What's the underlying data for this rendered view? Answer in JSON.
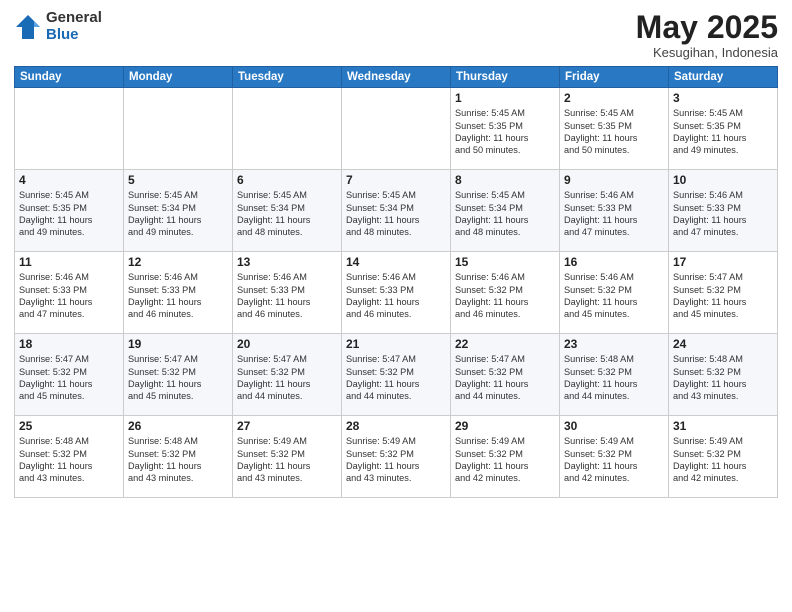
{
  "logo": {
    "general": "General",
    "blue": "Blue"
  },
  "header": {
    "month": "May 2025",
    "location": "Kesugihan, Indonesia"
  },
  "days_of_week": [
    "Sunday",
    "Monday",
    "Tuesday",
    "Wednesday",
    "Thursday",
    "Friday",
    "Saturday"
  ],
  "weeks": [
    [
      {
        "day": "",
        "detail": ""
      },
      {
        "day": "",
        "detail": ""
      },
      {
        "day": "",
        "detail": ""
      },
      {
        "day": "",
        "detail": ""
      },
      {
        "day": "1",
        "detail": "Sunrise: 5:45 AM\nSunset: 5:35 PM\nDaylight: 11 hours\nand 50 minutes."
      },
      {
        "day": "2",
        "detail": "Sunrise: 5:45 AM\nSunset: 5:35 PM\nDaylight: 11 hours\nand 50 minutes."
      },
      {
        "day": "3",
        "detail": "Sunrise: 5:45 AM\nSunset: 5:35 PM\nDaylight: 11 hours\nand 49 minutes."
      }
    ],
    [
      {
        "day": "4",
        "detail": "Sunrise: 5:45 AM\nSunset: 5:35 PM\nDaylight: 11 hours\nand 49 minutes."
      },
      {
        "day": "5",
        "detail": "Sunrise: 5:45 AM\nSunset: 5:34 PM\nDaylight: 11 hours\nand 49 minutes."
      },
      {
        "day": "6",
        "detail": "Sunrise: 5:45 AM\nSunset: 5:34 PM\nDaylight: 11 hours\nand 48 minutes."
      },
      {
        "day": "7",
        "detail": "Sunrise: 5:45 AM\nSunset: 5:34 PM\nDaylight: 11 hours\nand 48 minutes."
      },
      {
        "day": "8",
        "detail": "Sunrise: 5:45 AM\nSunset: 5:34 PM\nDaylight: 11 hours\nand 48 minutes."
      },
      {
        "day": "9",
        "detail": "Sunrise: 5:46 AM\nSunset: 5:33 PM\nDaylight: 11 hours\nand 47 minutes."
      },
      {
        "day": "10",
        "detail": "Sunrise: 5:46 AM\nSunset: 5:33 PM\nDaylight: 11 hours\nand 47 minutes."
      }
    ],
    [
      {
        "day": "11",
        "detail": "Sunrise: 5:46 AM\nSunset: 5:33 PM\nDaylight: 11 hours\nand 47 minutes."
      },
      {
        "day": "12",
        "detail": "Sunrise: 5:46 AM\nSunset: 5:33 PM\nDaylight: 11 hours\nand 46 minutes."
      },
      {
        "day": "13",
        "detail": "Sunrise: 5:46 AM\nSunset: 5:33 PM\nDaylight: 11 hours\nand 46 minutes."
      },
      {
        "day": "14",
        "detail": "Sunrise: 5:46 AM\nSunset: 5:33 PM\nDaylight: 11 hours\nand 46 minutes."
      },
      {
        "day": "15",
        "detail": "Sunrise: 5:46 AM\nSunset: 5:32 PM\nDaylight: 11 hours\nand 46 minutes."
      },
      {
        "day": "16",
        "detail": "Sunrise: 5:46 AM\nSunset: 5:32 PM\nDaylight: 11 hours\nand 45 minutes."
      },
      {
        "day": "17",
        "detail": "Sunrise: 5:47 AM\nSunset: 5:32 PM\nDaylight: 11 hours\nand 45 minutes."
      }
    ],
    [
      {
        "day": "18",
        "detail": "Sunrise: 5:47 AM\nSunset: 5:32 PM\nDaylight: 11 hours\nand 45 minutes."
      },
      {
        "day": "19",
        "detail": "Sunrise: 5:47 AM\nSunset: 5:32 PM\nDaylight: 11 hours\nand 45 minutes."
      },
      {
        "day": "20",
        "detail": "Sunrise: 5:47 AM\nSunset: 5:32 PM\nDaylight: 11 hours\nand 44 minutes."
      },
      {
        "day": "21",
        "detail": "Sunrise: 5:47 AM\nSunset: 5:32 PM\nDaylight: 11 hours\nand 44 minutes."
      },
      {
        "day": "22",
        "detail": "Sunrise: 5:47 AM\nSunset: 5:32 PM\nDaylight: 11 hours\nand 44 minutes."
      },
      {
        "day": "23",
        "detail": "Sunrise: 5:48 AM\nSunset: 5:32 PM\nDaylight: 11 hours\nand 44 minutes."
      },
      {
        "day": "24",
        "detail": "Sunrise: 5:48 AM\nSunset: 5:32 PM\nDaylight: 11 hours\nand 43 minutes."
      }
    ],
    [
      {
        "day": "25",
        "detail": "Sunrise: 5:48 AM\nSunset: 5:32 PM\nDaylight: 11 hours\nand 43 minutes."
      },
      {
        "day": "26",
        "detail": "Sunrise: 5:48 AM\nSunset: 5:32 PM\nDaylight: 11 hours\nand 43 minutes."
      },
      {
        "day": "27",
        "detail": "Sunrise: 5:49 AM\nSunset: 5:32 PM\nDaylight: 11 hours\nand 43 minutes."
      },
      {
        "day": "28",
        "detail": "Sunrise: 5:49 AM\nSunset: 5:32 PM\nDaylight: 11 hours\nand 43 minutes."
      },
      {
        "day": "29",
        "detail": "Sunrise: 5:49 AM\nSunset: 5:32 PM\nDaylight: 11 hours\nand 42 minutes."
      },
      {
        "day": "30",
        "detail": "Sunrise: 5:49 AM\nSunset: 5:32 PM\nDaylight: 11 hours\nand 42 minutes."
      },
      {
        "day": "31",
        "detail": "Sunrise: 5:49 AM\nSunset: 5:32 PM\nDaylight: 11 hours\nand 42 minutes."
      }
    ]
  ]
}
